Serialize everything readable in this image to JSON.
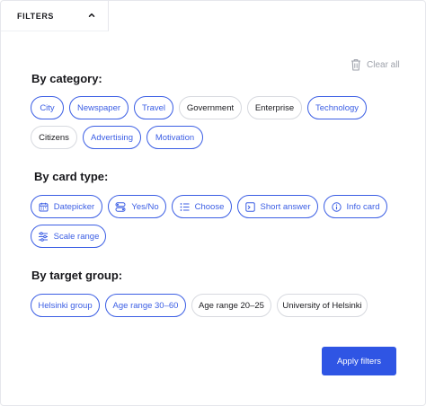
{
  "header": {
    "tab_label": "FILTERS",
    "tab_icon": "chevron-up-icon"
  },
  "clear_all": {
    "label": "Clear all",
    "icon": "trash-icon"
  },
  "sections": {
    "category": {
      "title": "By category:",
      "chips": [
        {
          "label": "City",
          "selected": true
        },
        {
          "label": "Newspaper",
          "selected": true
        },
        {
          "label": "Travel",
          "selected": true
        },
        {
          "label": "Government",
          "selected": false
        },
        {
          "label": "Enterprise",
          "selected": false
        },
        {
          "label": "Technology",
          "selected": true
        },
        {
          "label": "Citizens",
          "selected": false
        },
        {
          "label": "Advertising",
          "selected": true
        },
        {
          "label": "Motivation",
          "selected": true
        }
      ]
    },
    "card_type": {
      "title": "By card type:",
      "chips": [
        {
          "label": "Datepicker",
          "icon": "calendar-icon",
          "selected": true
        },
        {
          "label": "Yes/No",
          "icon": "toggle-icon",
          "selected": true
        },
        {
          "label": "Choose",
          "icon": "list-icon",
          "selected": true
        },
        {
          "label": "Short answer",
          "icon": "text-box-icon",
          "selected": true
        },
        {
          "label": "Info card",
          "icon": "info-icon",
          "selected": true
        },
        {
          "label": "Scale range",
          "icon": "sliders-icon",
          "selected": true
        }
      ]
    },
    "target_group": {
      "title": "By target group:",
      "chips": [
        {
          "label": "Helsinki group",
          "selected": true
        },
        {
          "label": "Age range 30–60",
          "selected": true
        },
        {
          "label": "Age range 20–25",
          "selected": false
        },
        {
          "label": "University of Helsinki",
          "selected": false
        }
      ]
    }
  },
  "apply_button": {
    "label": "Apply filters"
  },
  "colors": {
    "accent": "#3b5ee4",
    "button": "#2f55e4",
    "border": "#d7d9df",
    "muted": "#9ea2ab"
  }
}
